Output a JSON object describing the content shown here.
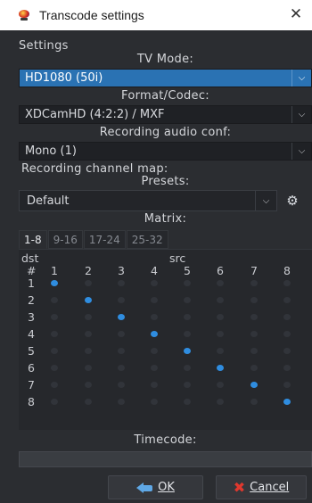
{
  "window": {
    "title": "Transcode settings",
    "close_glyph": "✕"
  },
  "settings_label": "Settings",
  "tv_mode": {
    "label": "TV Mode:",
    "value": "HD1080 (50i)"
  },
  "format": {
    "label": "Format/Codec:",
    "value": "XDCamHD (4:2:2) / MXF"
  },
  "audio": {
    "label": "Recording audio conf:",
    "value": "Mono (1)"
  },
  "channel_map": {
    "label": "Recording channel map:",
    "presets_label": "Presets:",
    "preset_value": "Default",
    "matrix_label": "Matrix:",
    "tabs": [
      "1-8",
      "9-16",
      "17-24",
      "25-32"
    ],
    "active_tab": 0,
    "dst_label": "dst",
    "src_label": "src",
    "hash_label": "#",
    "columns": [
      "1",
      "2",
      "3",
      "4",
      "5",
      "6",
      "7",
      "8"
    ],
    "rows": [
      "1",
      "2",
      "3",
      "4",
      "5",
      "6",
      "7",
      "8"
    ],
    "mapping": [
      1,
      2,
      3,
      4,
      5,
      6,
      7,
      8
    ]
  },
  "timecode": {
    "label": "Timecode:",
    "value": ""
  },
  "buttons": {
    "ok": "OK",
    "cancel": "Cancel"
  },
  "colors": {
    "accent": "#2a72b3",
    "dot_on": "#2f8de0",
    "dot_off": "#31343a",
    "cancel_icon": "#e0382e"
  },
  "icons": {
    "app": "tv-icon",
    "ok": "back-arrow-icon",
    "cancel": "x-icon",
    "preset_settings": "gear-icon"
  }
}
